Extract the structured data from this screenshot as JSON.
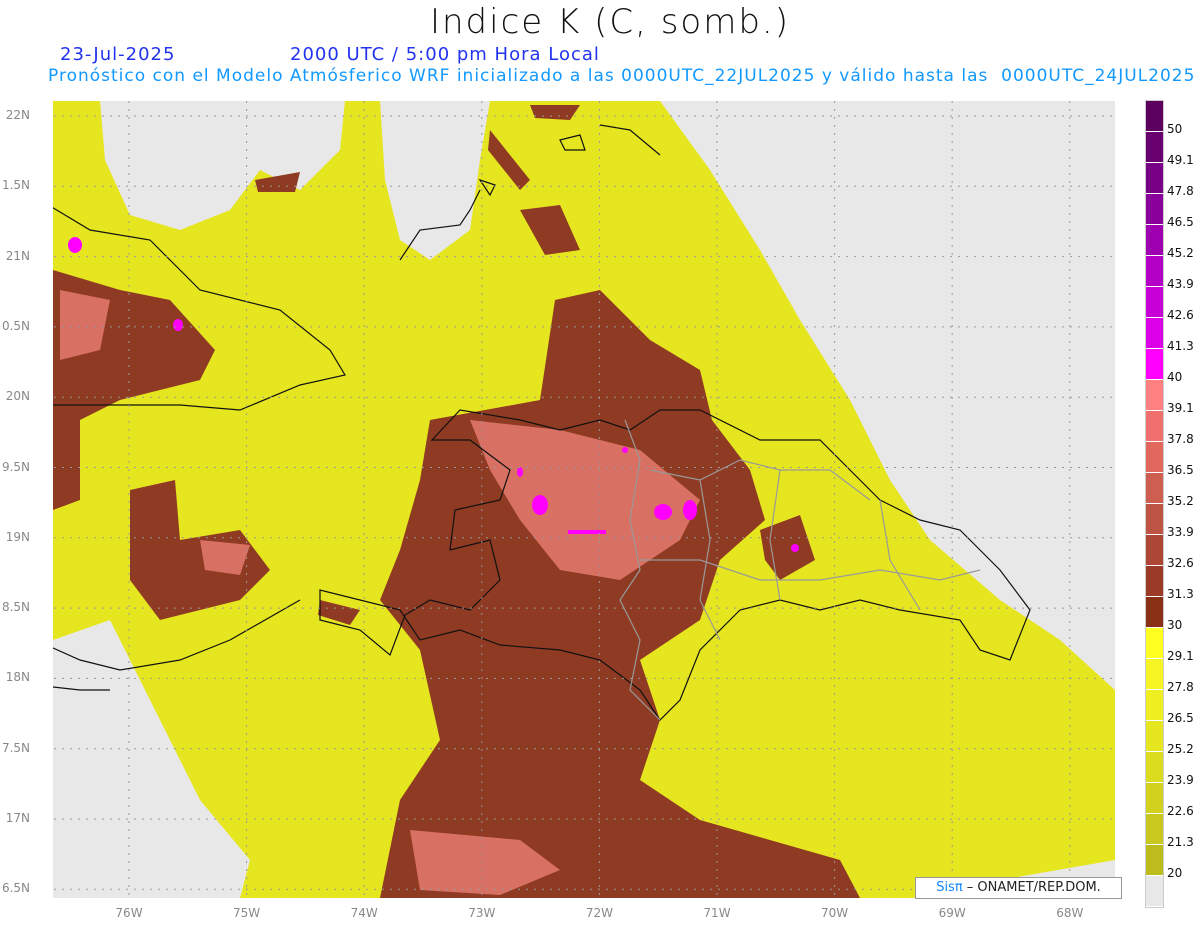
{
  "header": {
    "title": "Indice K (C, somb.)",
    "date": "23-Jul-2025",
    "time": "2000 UTC / 5:00 pm Hora Local",
    "description": "Pronóstico con el Modelo Atmósferico WRF inicializado a las 0000UTC_22JUL2025 y válido hasta las  0000UTC_24JUL2025"
  },
  "axes": {
    "lat_labels": [
      "22N",
      "1.5N",
      "21N",
      "0.5N",
      "20N",
      "9.5N",
      "19N",
      "8.5N",
      "18N",
      "7.5N",
      "17N",
      "6.5N"
    ],
    "lon_labels": [
      "76W",
      "75W",
      "74W",
      "73W",
      "72W",
      "71W",
      "70W",
      "69W",
      "68W"
    ]
  },
  "colorbar": {
    "labels": [
      "50",
      "49.1",
      "47.8",
      "46.5",
      "45.2",
      "43.9",
      "42.6",
      "41.3",
      "40",
      "39.1",
      "37.8",
      "36.5",
      "35.2",
      "33.9",
      "32.6",
      "31.3",
      "30",
      "29.1",
      "27.8",
      "26.5",
      "25.2",
      "23.9",
      "22.6",
      "21.3",
      "20"
    ],
    "colors": [
      "#5c0060",
      "#680070",
      "#780086",
      "#8a009a",
      "#9e00b0",
      "#b400c6",
      "#c800d8",
      "#dc00e8",
      "#ff00ff",
      "#ff8080",
      "#f07070",
      "#e2685e",
      "#ce5e50",
      "#be5444",
      "#ae4636",
      "#9c3a28",
      "#8a3016",
      "#ffff22",
      "#f6f422",
      "#eeee20",
      "#e6e620",
      "#dcdc1e",
      "#d2d21e",
      "#c8c81e",
      "#bcbc1c",
      "#e8e8e8"
    ]
  },
  "credit": {
    "brand": "Sisπ",
    "text": " – ONAMET/REP.DOM."
  },
  "colors": {
    "nodata": "#e8e8e8",
    "yellow": "#eaea22",
    "brown": "#8f3a22",
    "pink": "#e0786a",
    "magenta": "#ff00ff"
  }
}
